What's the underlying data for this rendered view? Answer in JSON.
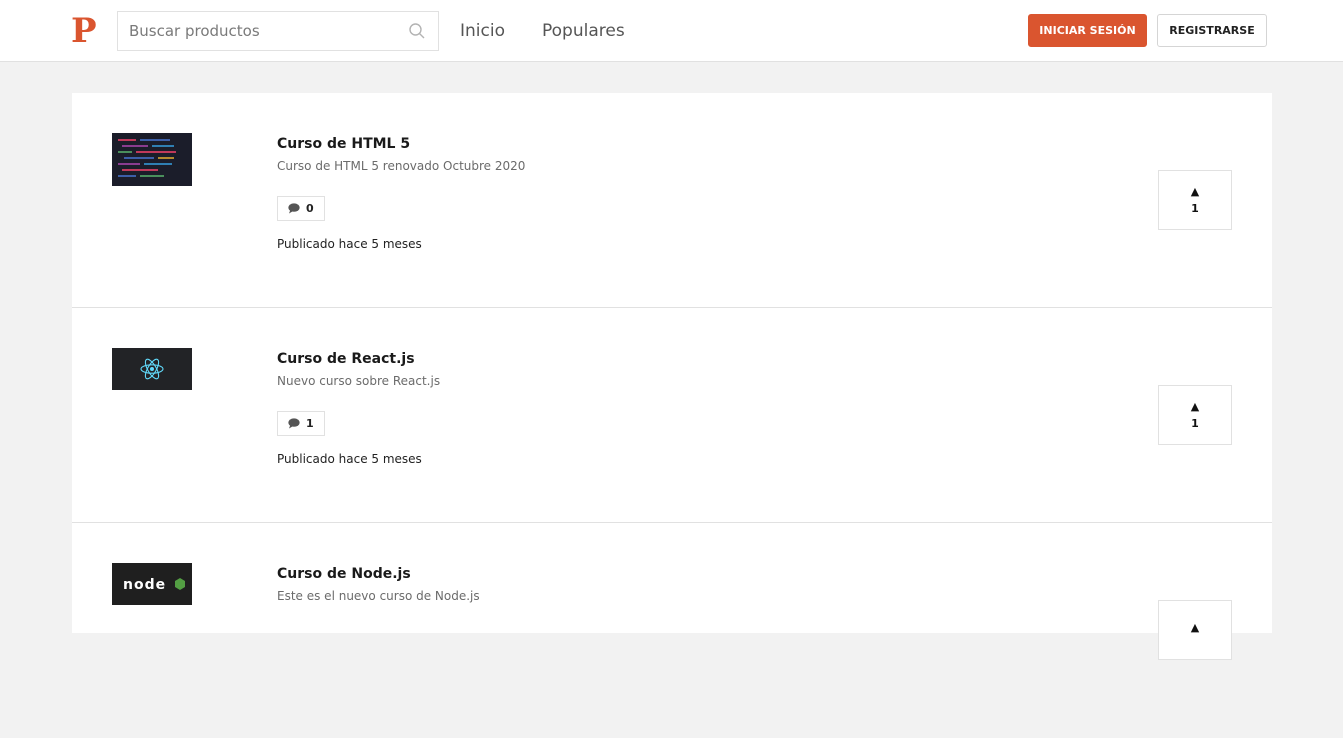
{
  "header": {
    "logo": "P",
    "search": {
      "placeholder": "Buscar productos",
      "value": ""
    },
    "nav": [
      "Inicio",
      "Populares"
    ],
    "login_label": "Iniciar Sesión",
    "register_label": "Registrarse",
    "accent_color": "#da552f"
  },
  "products": [
    {
      "title": "Curso de HTML 5",
      "description": "Curso de HTML 5 renovado Octubre 2020",
      "comments": "0",
      "published": "Publicado hace 5 meses",
      "votes": "1",
      "thumb_icon": "code-thumbnail"
    },
    {
      "title": "Curso de React.js",
      "description": "Nuevo curso sobre React.js",
      "comments": "1",
      "published": "Publicado hace 5 meses",
      "votes": "1",
      "thumb_icon": "react-logo"
    },
    {
      "title": "Curso de Node.js",
      "description": "Este es el nuevo curso de Node.js",
      "comments": "",
      "published": "",
      "votes": "",
      "thumb_icon": "node-logo",
      "thumb_text": "node"
    }
  ]
}
